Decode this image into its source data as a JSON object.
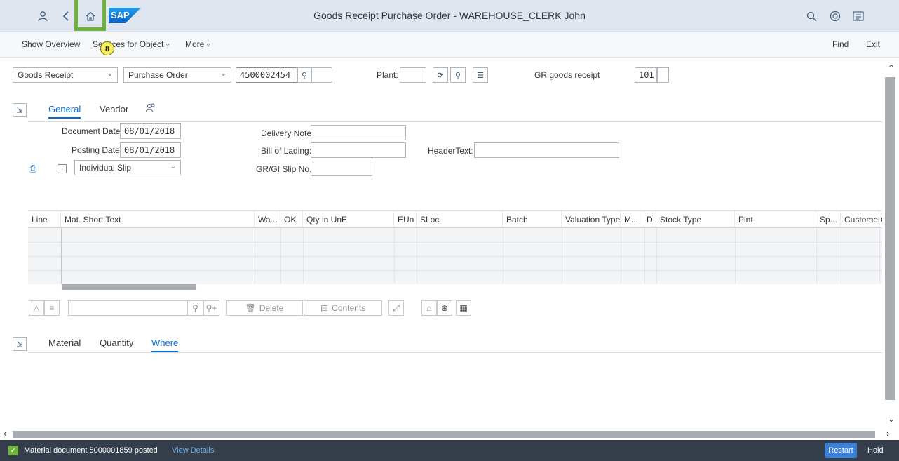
{
  "shell": {
    "title": "Goods Receipt Purchase Order - WAREHOUSE_CLERK John",
    "logo_text": "SAP",
    "icons": [
      "user-icon",
      "back-icon",
      "home-icon",
      "search-icon",
      "help-icon",
      "menu-icon"
    ]
  },
  "annotation": {
    "badge": "8"
  },
  "toolbar": {
    "show_overview": "Show Overview",
    "services": "Services for Object",
    "more": "More",
    "find": "Find",
    "exit": "Exit"
  },
  "header": {
    "action": "Goods Receipt",
    "reference": "Purchase Order",
    "po_number": "4500002454",
    "plant_label": "Plant:",
    "plant_value": "",
    "gr_label": "GR goods receipt",
    "movement_type": "101"
  },
  "tabs_top": {
    "general": "General",
    "vendor": "Vendor"
  },
  "general": {
    "doc_date_label": "Document Date:",
    "doc_date": "08/01/2018",
    "post_date_label": "Posting Date:",
    "post_date": "08/01/2018",
    "slip_option": "Individual Slip",
    "delivery_note_label": "Delivery Note:",
    "bill_label": "Bill of Lading:",
    "slip_no_label": "GR/GI Slip No.:",
    "header_text_label": "HeaderText:"
  },
  "table": {
    "columns": [
      "Line",
      "Mat. Short Text",
      "Wa...",
      "OK",
      "Qty in UnE",
      "EUn",
      "SLoc",
      "Batch",
      "Valuation Type",
      "M...",
      "D..",
      "Stock Type",
      "Plnt",
      "Sp...",
      "Customer",
      "G"
    ]
  },
  "lower_toolbar": {
    "delete": "Delete",
    "contents": "Contents"
  },
  "tabs_bottom": {
    "material": "Material",
    "quantity": "Quantity",
    "where": "Where"
  },
  "status": {
    "message": "Material document 5000001859 posted",
    "link": "View Details",
    "restart": "Restart",
    "hold": "Hold"
  },
  "colors": {
    "accent": "#0a6ed1",
    "shell": "#dfe6ef",
    "status_bg": "#333e4a",
    "highlight": "#6fb33a"
  }
}
